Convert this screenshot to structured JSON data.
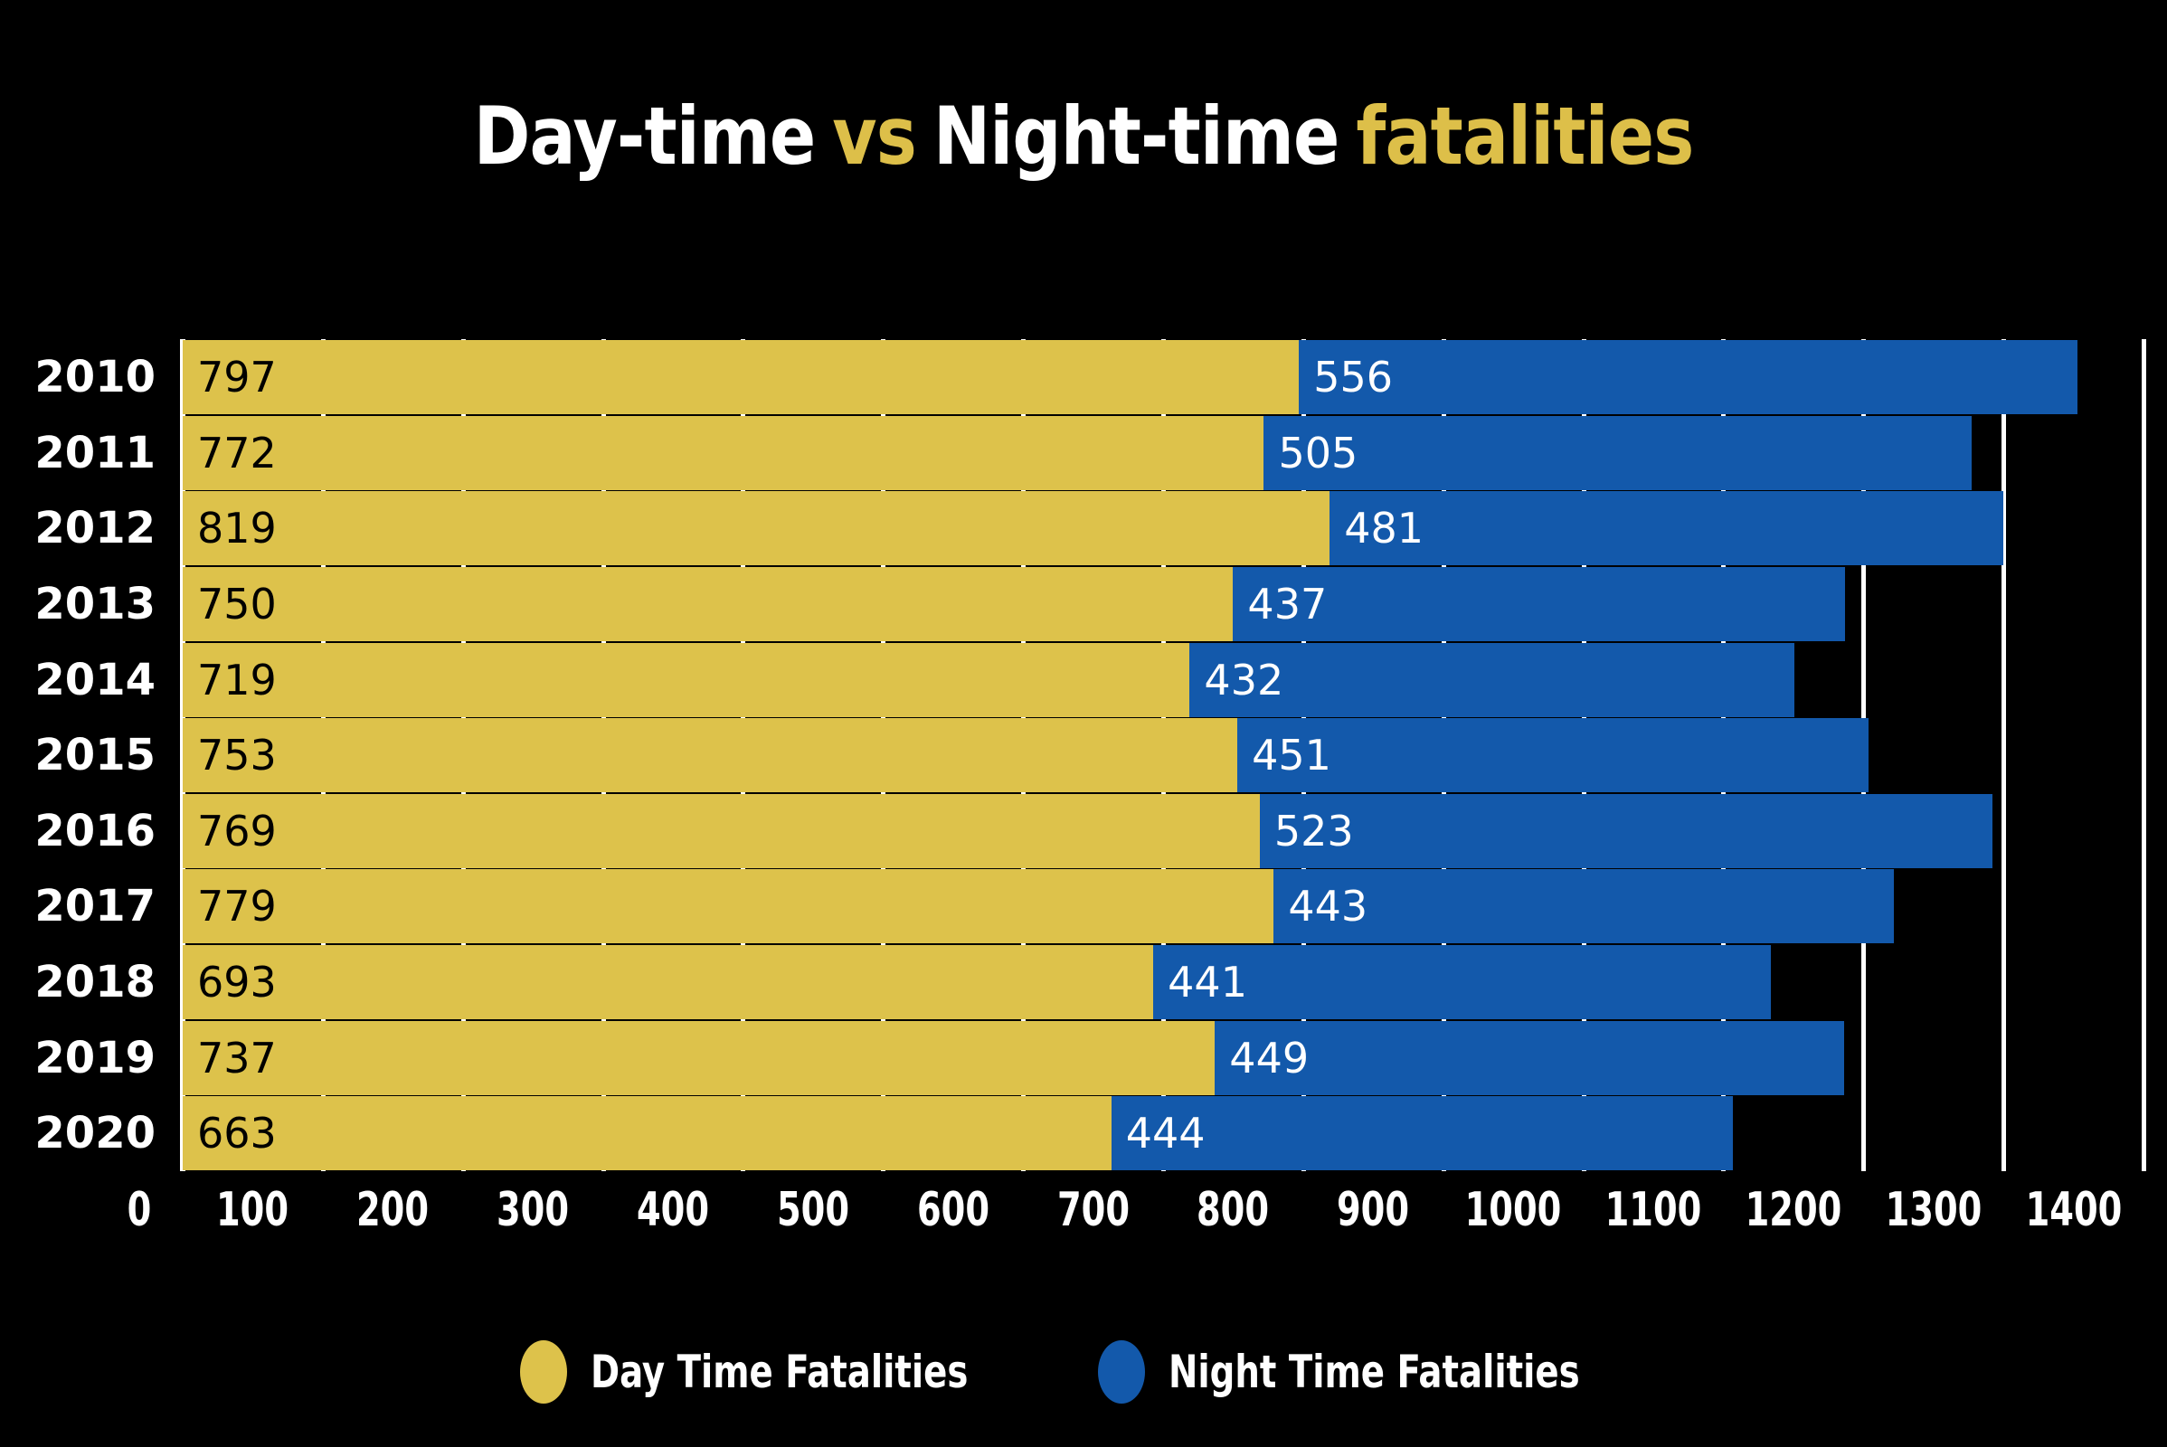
{
  "title": {
    "part1": "Day-time",
    "part2": "vs",
    "part3": "Night-time",
    "part4": "fatalities"
  },
  "colors": {
    "background": "#000000",
    "day": "#ddc24b",
    "night": "#1359ab",
    "gridline": "#ffffff",
    "text": "#ffffff"
  },
  "legend": {
    "items": [
      {
        "label": "Day Time Fatalities",
        "color": "#ddc24b",
        "marker": "ellipse-marker"
      },
      {
        "label": "Night Time Fatalities",
        "color": "#1359ab",
        "marker": "ellipse-marker"
      }
    ]
  },
  "chart_data": {
    "type": "bar",
    "orientation": "horizontal",
    "stacked": true,
    "title": "Day-time vs Night-time fatalities",
    "xlabel": "",
    "ylabel": "",
    "xlim": [
      0,
      1400
    ],
    "xticks": [
      0,
      100,
      200,
      300,
      400,
      500,
      600,
      700,
      800,
      900,
      1000,
      1100,
      1200,
      1300,
      1400
    ],
    "xtick_labels": [
      "0",
      "100",
      "200",
      "300",
      "400",
      "500",
      "600",
      "700",
      "800",
      "900",
      "1000",
      "1100",
      "1200",
      "1300",
      "1400"
    ],
    "grid": true,
    "legend_position": "bottom",
    "categories": [
      "2010",
      "2011",
      "2012",
      "2013",
      "2014",
      "2015",
      "2016",
      "2017",
      "2018",
      "2019",
      "2020"
    ],
    "series": [
      {
        "name": "Day Time Fatalities",
        "color": "#ddc24b",
        "values": [
          797,
          772,
          819,
          750,
          719,
          753,
          769,
          779,
          693,
          737,
          663
        ]
      },
      {
        "name": "Night Time Fatalities",
        "color": "#1359ab",
        "values": [
          556,
          505,
          481,
          437,
          432,
          451,
          523,
          443,
          441,
          449,
          444
        ]
      }
    ]
  }
}
